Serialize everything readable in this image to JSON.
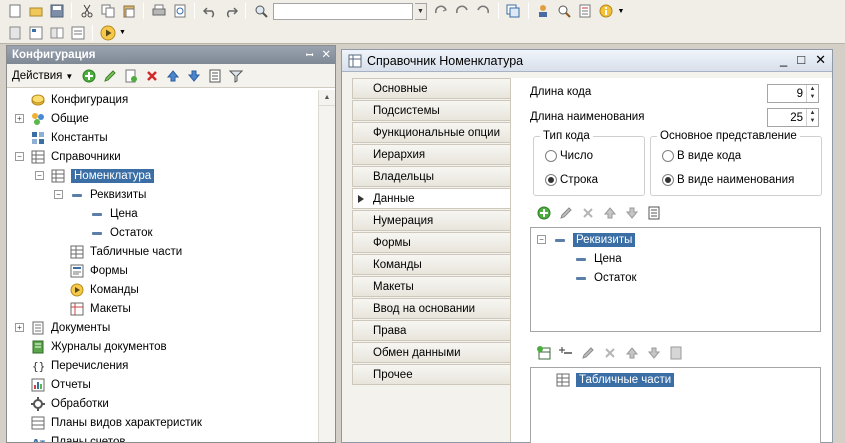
{
  "toolbar": {
    "row1_icons": [
      "new-doc-icon",
      "open-folder-icon",
      "save-icon",
      "sep",
      "cut-icon",
      "copy-icon",
      "paste-icon",
      "sep",
      "print-icon",
      "preview-icon",
      "sep",
      "undo-icon",
      "redo-icon",
      "sep",
      "find-icon",
      "search-box",
      "replace-icon",
      "find-next-icon",
      "find-prev-icon",
      "sep",
      "window-icon",
      "sep",
      "user-icon",
      "search-config-icon",
      "syntax-icon",
      "info-icon"
    ],
    "row2_icons": [
      "config-db-icon",
      "config-tree-icon",
      "compare-icon",
      "debug-icon",
      "run-icon"
    ]
  },
  "left_panel": {
    "title": "Конфигурация",
    "actions_label": "Действия",
    "tree": [
      {
        "label": "Конфигурация",
        "icon": "config-root-icon",
        "level": 0,
        "exp": ""
      },
      {
        "label": "Общие",
        "icon": "common-icon",
        "level": 0,
        "exp": "+"
      },
      {
        "label": "Константы",
        "icon": "constants-icon",
        "level": 0,
        "exp": ""
      },
      {
        "label": "Справочники",
        "icon": "catalog-icon",
        "level": 0,
        "exp": "−"
      },
      {
        "label": "Номенклатура",
        "icon": "catalog-icon",
        "level": 1,
        "exp": "−",
        "selected": true
      },
      {
        "label": "Реквизиты",
        "icon": "attribute-icon",
        "level": 2,
        "exp": "−"
      },
      {
        "label": "Цена",
        "icon": "attribute-icon",
        "level": 3,
        "exp": ""
      },
      {
        "label": "Остаток",
        "icon": "attribute-icon",
        "level": 3,
        "exp": ""
      },
      {
        "label": "Табличные части",
        "icon": "tabular-part-icon",
        "level": 2,
        "exp": ""
      },
      {
        "label": "Формы",
        "icon": "form-icon",
        "level": 2,
        "exp": ""
      },
      {
        "label": "Команды",
        "icon": "command-icon",
        "level": 2,
        "exp": ""
      },
      {
        "label": "Макеты",
        "icon": "template-icon",
        "level": 2,
        "exp": ""
      },
      {
        "label": "Документы",
        "icon": "document-icon",
        "level": 0,
        "exp": "+"
      },
      {
        "label": "Журналы документов",
        "icon": "journal-icon",
        "level": 0,
        "exp": ""
      },
      {
        "label": "Перечисления",
        "icon": "enum-icon",
        "level": 0,
        "exp": ""
      },
      {
        "label": "Отчеты",
        "icon": "report-icon",
        "level": 0,
        "exp": ""
      },
      {
        "label": "Обработки",
        "icon": "processing-icon",
        "level": 0,
        "exp": ""
      },
      {
        "label": "Планы видов характеристик",
        "icon": "chart-types-icon",
        "level": 0,
        "exp": ""
      },
      {
        "label": "Планы счетов",
        "icon": "accounts-icon",
        "level": 0,
        "exp": ""
      }
    ]
  },
  "window": {
    "title": "Справочник Номенклатура",
    "tabs": [
      "Основные",
      "Подсистемы",
      "Функциональные опции",
      "Иерархия",
      "Владельцы",
      "Данные",
      "Нумерация",
      "Формы",
      "Команды",
      "Макеты",
      "Ввод на основании",
      "Права",
      "Обмен данными",
      "Прочее"
    ],
    "active_tab_index": 5,
    "data": {
      "code_length_label": "Длина кода",
      "code_length_value": "9",
      "name_length_label": "Длина наименования",
      "name_length_value": "25",
      "code_type": {
        "legend": "Тип кода",
        "options": [
          "Число",
          "Строка"
        ],
        "selected_index": 1
      },
      "main_repr": {
        "legend": "Основное представление",
        "options": [
          "В виде кода",
          "В виде наименования"
        ],
        "selected_index": 1
      },
      "attributes_tree": [
        {
          "label": "Реквизиты",
          "level": 0,
          "selected": true
        },
        {
          "label": "Цена",
          "level": 1
        },
        {
          "label": "Остаток",
          "level": 1
        }
      ],
      "tabular_parts_tree": [
        {
          "label": "Табличные части",
          "level": 0,
          "selected": true
        }
      ]
    }
  }
}
